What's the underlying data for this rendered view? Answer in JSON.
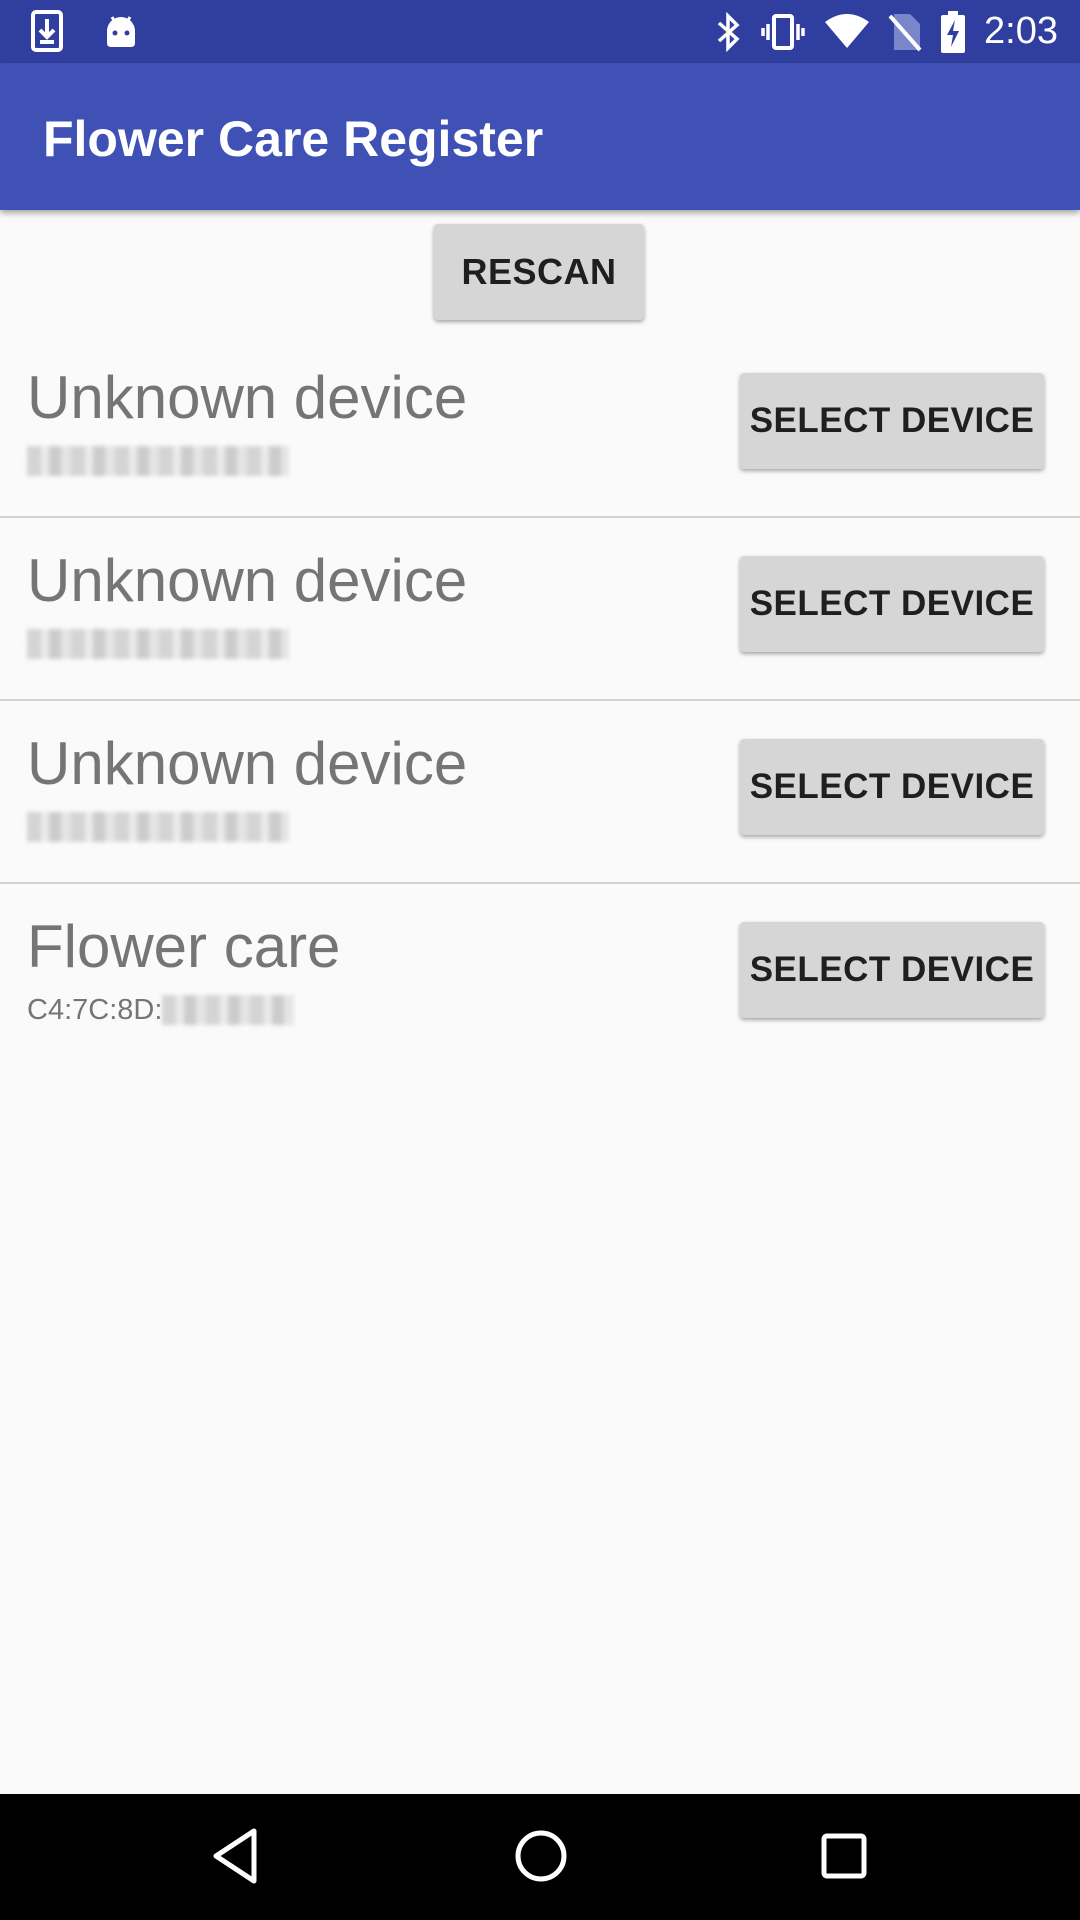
{
  "status_bar": {
    "time": "2:03",
    "left_icons": [
      "download-icon",
      "android-icon"
    ],
    "right_icons": [
      "bluetooth-icon",
      "vibrate-icon",
      "wifi-icon",
      "no-sim-icon",
      "battery-charging-icon"
    ]
  },
  "app_bar": {
    "title": "Flower Care Register",
    "color": "#3f51b5"
  },
  "rescan_label": "RESCAN",
  "devices": [
    {
      "name": "Unknown device",
      "address": "",
      "address_prefix": "",
      "address_redacted": true,
      "button_label": "SELECT DEVICE"
    },
    {
      "name": "Unknown device",
      "address": "",
      "address_prefix": "",
      "address_redacted": true,
      "button_label": "SELECT DEVICE"
    },
    {
      "name": "Unknown device",
      "address": "",
      "address_prefix": "",
      "address_redacted": true,
      "button_label": "SELECT DEVICE"
    },
    {
      "name": "Flower care",
      "address_prefix": "C4:7C:8D:",
      "address_redacted": true,
      "button_label": "SELECT DEVICE"
    }
  ],
  "nav_bar": {
    "buttons": [
      "back-icon",
      "home-icon",
      "recents-icon"
    ]
  }
}
